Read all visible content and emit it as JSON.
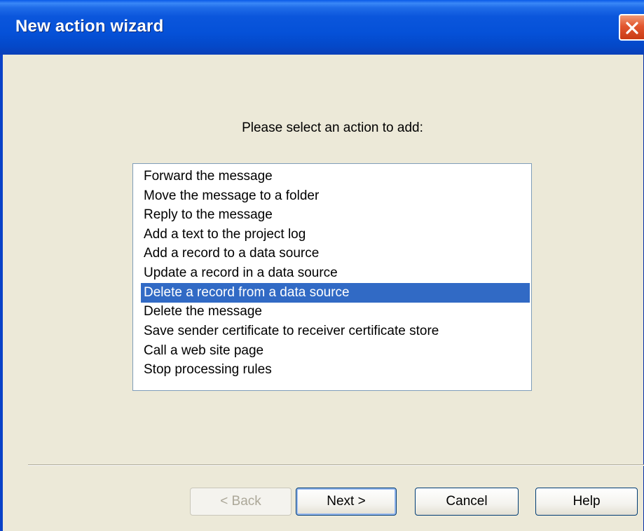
{
  "window": {
    "title": "New action wizard",
    "accent_color": "#0a56dc",
    "close_icon": "close-icon"
  },
  "prompt": "Please select an action to add:",
  "actions": {
    "items": [
      "Forward the message",
      "Move the message to a folder",
      "Reply to the message",
      "Add a text to the project log",
      "Add a record to a data source",
      "Update a record in a data source",
      "Delete a record from a data source",
      "Delete the message",
      "Save sender certificate to receiver certificate store",
      "Call a web site page",
      "Stop processing rules"
    ],
    "selected_index": 6,
    "selection_color": "#316ac5"
  },
  "buttons": {
    "back": "< Back",
    "next": "Next >",
    "cancel": "Cancel",
    "help": "Help"
  }
}
